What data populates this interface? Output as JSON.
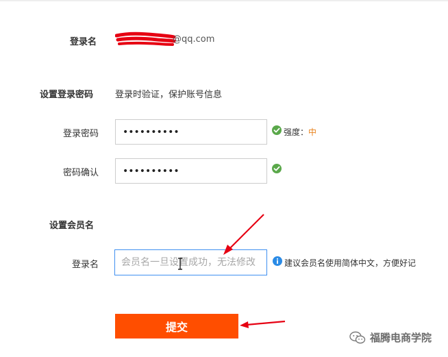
{
  "account": {
    "login_name_label": "登录名",
    "email_suffix": "@qq.com"
  },
  "password_section": {
    "heading": "设置登录密码",
    "description": "登录时验证，保护账号信息",
    "password_label": "登录密码",
    "password_value": "••••••••••",
    "strength_label": "强度：",
    "strength_value": "中",
    "confirm_label": "密码确认",
    "confirm_value": "••••••••••"
  },
  "member_section": {
    "heading": "设置会员名",
    "login_label": "登录名",
    "login_placeholder": "会员名一旦设置成功，无法修改",
    "hint": "建议会员名使用简体中文，方便好记"
  },
  "submit_label": "提交",
  "watermark": "福腾电商学院",
  "colors": {
    "accent": "#ff4e00",
    "check": "#5aa84a",
    "info": "#2b8be6",
    "annotation": "#e60012",
    "strength_mid": "#e8821c"
  }
}
